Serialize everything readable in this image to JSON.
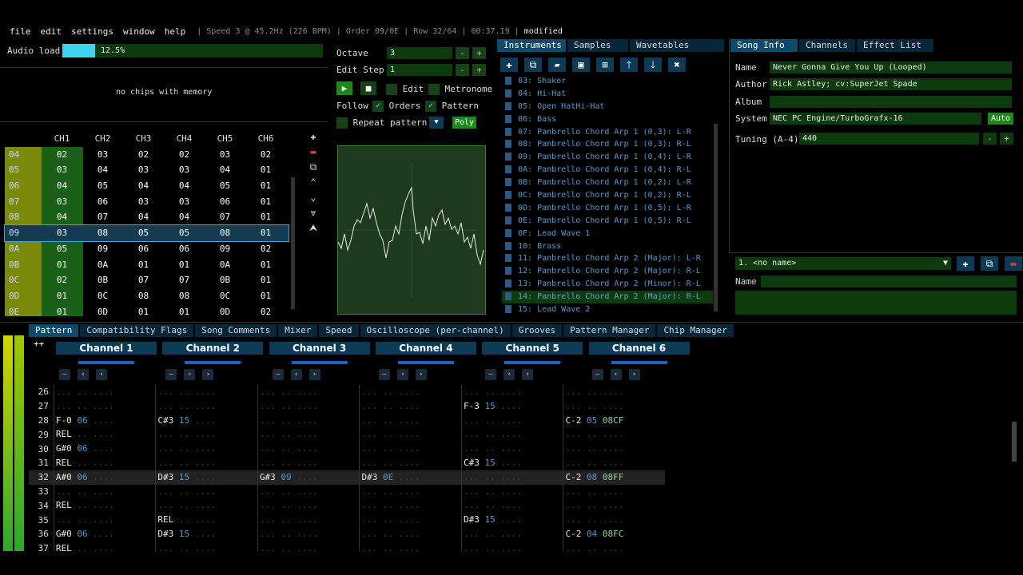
{
  "menu": [
    "file",
    "edit",
    "settings",
    "window",
    "help"
  ],
  "status": {
    "speed": "Speed 3 @ 45.2Hz (226 BPM)",
    "order": "Order 09/0E",
    "row": "Row 32/64",
    "time": "00:37.19",
    "modified": "modified"
  },
  "audio_load": {
    "label": "Audio load",
    "value": "12.5%",
    "fraction": 0.125
  },
  "memory_msg": "no chips with memory",
  "pattern_header": {
    "channels": [
      "CH1",
      "CH2",
      "CH3",
      "CH4",
      "CH5",
      "CH6"
    ]
  },
  "orders": [
    {
      "row": "04",
      "vals": [
        "02",
        "03",
        "02",
        "02",
        "03",
        "02"
      ]
    },
    {
      "row": "05",
      "vals": [
        "03",
        "04",
        "03",
        "03",
        "04",
        "01"
      ]
    },
    {
      "row": "06",
      "vals": [
        "04",
        "05",
        "04",
        "04",
        "05",
        "01"
      ]
    },
    {
      "row": "07",
      "vals": [
        "03",
        "06",
        "03",
        "03",
        "06",
        "01"
      ]
    },
    {
      "row": "08",
      "vals": [
        "04",
        "07",
        "04",
        "04",
        "07",
        "01"
      ]
    },
    {
      "row": "09",
      "vals": [
        "03",
        "08",
        "05",
        "05",
        "08",
        "01"
      ]
    },
    {
      "row": "0A",
      "vals": [
        "05",
        "09",
        "06",
        "06",
        "09",
        "02"
      ]
    },
    {
      "row": "0B",
      "vals": [
        "01",
        "0A",
        "01",
        "01",
        "0A",
        "01"
      ]
    },
    {
      "row": "0C",
      "vals": [
        "02",
        "0B",
        "07",
        "07",
        "0B",
        "01"
      ]
    },
    {
      "row": "0D",
      "vals": [
        "01",
        "0C",
        "08",
        "08",
        "0C",
        "01"
      ]
    },
    {
      "row": "0E",
      "vals": [
        "01",
        "0D",
        "01",
        "01",
        "0D",
        "02"
      ]
    }
  ],
  "controls": {
    "octave_label": "Octave",
    "octave": "3",
    "edit_step_label": "Edit Step",
    "edit_step": "1",
    "edit": "Edit",
    "metronome": "Metronome",
    "follow": "Follow",
    "orders": "Orders",
    "pattern": "Pattern",
    "repeat": "Repeat pattern",
    "poly": "Poly"
  },
  "inst_tabs": [
    "Instruments",
    "Samples",
    "Wavetables"
  ],
  "instruments": [
    "03: Shaker",
    "04: Hi-Hat",
    "05: Open HatHi-Hat",
    "06: Bass",
    "07: Panbrello Chord Arp 1 (0,3): L-R",
    "08: Panbrello Chord Arp 1 (0,3): R-L",
    "09: Panbrello Chord Arp 1 (0,4): L-R",
    "0A: Panbrello Chord Arp 1 (0,4): R-L",
    "0B: Panbrello Chord Arp 1 (0,2): L-R",
    "0C: Panbrello Chord Arp 1 (0,2): R-L",
    "0D: Panbrello Chord Arp 1 (0,5): L-R",
    "0E: Panbrello Chord Arp 1 (0,5): R-L",
    "0F: Lead Wave 1",
    "10: Brass",
    "11: Panbrello Chord Arp 2 (Major): L-R",
    "12: Panbrello Chord Arp 2 (Major): R-L",
    "13: Panbrello Chord Arp 2 (Minor): R-L",
    "14: Panbrello Chord Arp 2 (Major): R-L",
    "15: Lead Wave 2"
  ],
  "song_tabs": [
    "Song Info",
    "Channels",
    "Effect List"
  ],
  "song": {
    "name_label": "Name",
    "name": "Never Gonna Give You Up (Looped)",
    "author_label": "Author",
    "author": "Rick Astley; cv:SuperJet Spade",
    "album_label": "Album",
    "album": "",
    "system_label": "System",
    "system": "NEC PC Engine/TurboGrafx-16",
    "auto": "Auto",
    "tuning_label": "Tuning (A-4)",
    "tuning": "440"
  },
  "subsong": {
    "selected": "1. <no name>",
    "name_label": "Name",
    "name": ""
  },
  "bottom_tabs": [
    "Pattern",
    "Compatibility Flags",
    "Song Comments",
    "Mixer",
    "Speed",
    "Oscilloscope (per-channel)",
    "Grooves",
    "Pattern Manager",
    "Chip Manager"
  ],
  "channels": [
    "Channel 1",
    "Channel 2",
    "Channel 3",
    "Channel 4",
    "Channel 5",
    "Channel 6"
  ],
  "pattern_rows": [
    {
      "n": "26",
      "cells": [
        [
          "",
          ""
        ],
        [
          "",
          ""
        ],
        [
          "",
          ""
        ],
        [
          "",
          ""
        ],
        [
          "",
          ""
        ],
        [
          "",
          ""
        ]
      ]
    },
    {
      "n": "27",
      "cells": [
        [
          "",
          ""
        ],
        [
          "",
          ""
        ],
        [
          "",
          ""
        ],
        [
          "",
          ""
        ],
        [
          "F-3",
          "15"
        ],
        [
          "",
          ""
        ]
      ]
    },
    {
      "n": "28",
      "cells": [
        [
          "F-0",
          "06"
        ],
        [
          "C#3",
          "15"
        ],
        [
          "",
          ""
        ],
        [
          "",
          ""
        ],
        [
          "",
          ""
        ],
        [
          "C-2",
          "05",
          "08CF"
        ]
      ]
    },
    {
      "n": "29",
      "cells": [
        [
          "REL",
          ""
        ],
        [
          "",
          ""
        ],
        [
          "",
          ""
        ],
        [
          "",
          ""
        ],
        [
          "",
          ""
        ],
        [
          "",
          ""
        ]
      ]
    },
    {
      "n": "30",
      "cells": [
        [
          "G#0",
          "06"
        ],
        [
          "",
          ""
        ],
        [
          "",
          ""
        ],
        [
          "",
          ""
        ],
        [
          "",
          ""
        ],
        [
          "",
          ""
        ]
      ]
    },
    {
      "n": "31",
      "cells": [
        [
          "REL",
          ""
        ],
        [
          "",
          ""
        ],
        [
          "",
          ""
        ],
        [
          "",
          ""
        ],
        [
          "C#3",
          "15"
        ],
        [
          "",
          ""
        ]
      ]
    },
    {
      "n": "32",
      "cells": [
        [
          "A#0",
          "06"
        ],
        [
          "D#3",
          "15"
        ],
        [
          "G#3",
          "09"
        ],
        [
          "D#3",
          "0E"
        ],
        [
          "",
          ""
        ],
        [
          "C-2",
          "08",
          "08FF"
        ]
      ]
    },
    {
      "n": "33",
      "cells": [
        [
          "",
          ""
        ],
        [
          "",
          ""
        ],
        [
          "",
          ""
        ],
        [
          "",
          ""
        ],
        [
          "",
          ""
        ],
        [
          "",
          ""
        ]
      ]
    },
    {
      "n": "34",
      "cells": [
        [
          "REL",
          ""
        ],
        [
          "",
          ""
        ],
        [
          "",
          ""
        ],
        [
          "",
          ""
        ],
        [
          "",
          ""
        ],
        [
          "",
          ""
        ]
      ]
    },
    {
      "n": "35",
      "cells": [
        [
          "",
          ""
        ],
        [
          "REL",
          ""
        ],
        [
          "",
          ""
        ],
        [
          "",
          ""
        ],
        [
          "D#3",
          "15"
        ],
        [
          "",
          ""
        ]
      ]
    },
    {
      "n": "36",
      "cells": [
        [
          "G#0",
          "06"
        ],
        [
          "D#3",
          "15"
        ],
        [
          "",
          ""
        ],
        [
          "",
          ""
        ],
        [
          "",
          ""
        ],
        [
          "C-2",
          "04",
          "08FC"
        ]
      ]
    },
    {
      "n": "37",
      "cells": [
        [
          "REL",
          ""
        ],
        [
          "",
          ""
        ],
        [
          "",
          ""
        ],
        [
          "",
          ""
        ],
        [
          "",
          ""
        ],
        [
          "",
          ""
        ]
      ]
    }
  ],
  "colors": {
    "accent": "#0d4a6b",
    "green_field": "#0e3b0e",
    "order_col": "#8a9a10"
  }
}
